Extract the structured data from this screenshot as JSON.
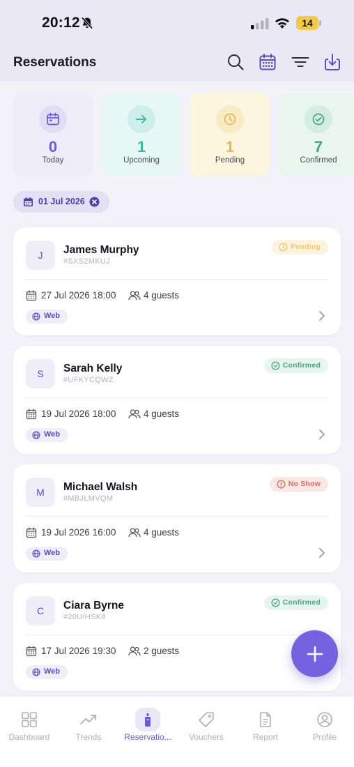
{
  "status_bar": {
    "time": "20:12",
    "battery": "14"
  },
  "header": {
    "title": "Reservations"
  },
  "stats": [
    {
      "value": "0",
      "label": "Today",
      "color": "#6a58d6",
      "bg": "#efecf9",
      "circle": "#e2ddf5"
    },
    {
      "value": "1",
      "label": "Upcoming",
      "color": "#3fb6a6",
      "bg": "#e7f7f6",
      "circle": "#cdeeeb"
    },
    {
      "value": "1",
      "label": "Pending",
      "color": "#e7b955",
      "bg": "#fdf6df",
      "circle": "#f9ebc4"
    },
    {
      "value": "7",
      "label": "Confirmed",
      "color": "#46a37f",
      "bg": "#e8f6ef",
      "circle": "#d3ede0"
    }
  ],
  "filter_chip": {
    "label": "01 Jul 2026"
  },
  "reservations": [
    {
      "initial": "J",
      "name": "James Murphy",
      "code": "#SXS2MKUJ",
      "status": "Pending",
      "date": "27 Jul 2026 18:00",
      "guests": "4 guests",
      "source": "Web"
    },
    {
      "initial": "S",
      "name": "Sarah Kelly",
      "code": "#UFKYCQWZ",
      "status": "Confirmed",
      "date": "19 Jul 2026 18:00",
      "guests": "4 guests",
      "source": "Web"
    },
    {
      "initial": "M",
      "name": "Michael Walsh",
      "code": "#MBJLMVQM",
      "status": "No Show",
      "date": "19 Jul 2026 16:00",
      "guests": "4 guests",
      "source": "Web"
    },
    {
      "initial": "C",
      "name": "Ciara Byrne",
      "code": "#20UIHSK8",
      "status": "Confirmed",
      "date": "17 Jul 2026 19:30",
      "guests": "2 guests",
      "source": "Web"
    }
  ],
  "tabs": [
    {
      "label": "Dashboard",
      "icon": "grid-icon"
    },
    {
      "label": "Trends",
      "icon": "trend-icon"
    },
    {
      "label": "Reservatio...",
      "icon": "reservation-icon",
      "active": true
    },
    {
      "label": "Vouchers",
      "icon": "tag-icon"
    },
    {
      "label": "Report",
      "icon": "report-icon"
    },
    {
      "label": "Profile",
      "icon": "profile-icon"
    }
  ],
  "colors": {
    "accent": "#6a58d6",
    "fab": "#7462df"
  }
}
